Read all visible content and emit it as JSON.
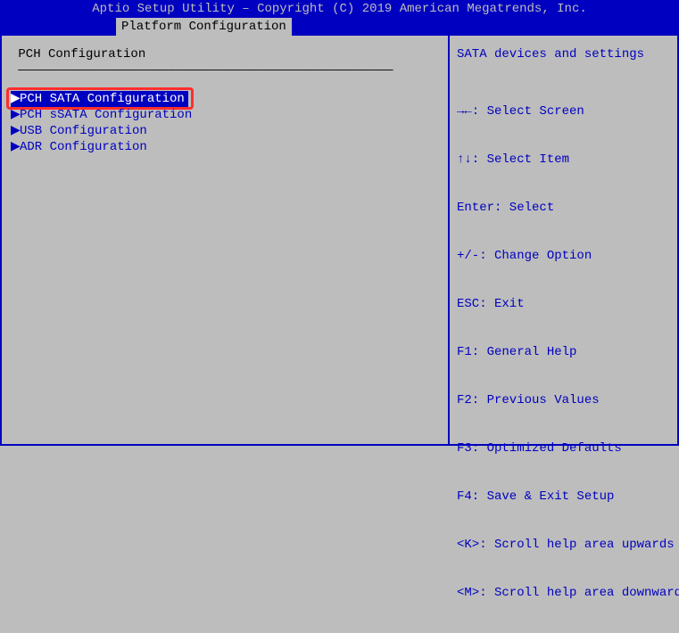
{
  "header": {
    "title": "Aptio Setup Utility – Copyright (C) 2019 American Megatrends, Inc.",
    "tab": "Platform Configuration"
  },
  "left": {
    "heading": " PCH Configuration",
    "divider": " ——————————————————————————————————————————————————",
    "items": [
      {
        "label": "PCH SATA Configuration",
        "selected": true
      },
      {
        "label": "PCH sSATA Configuration",
        "selected": false
      },
      {
        "label": "USB Configuration",
        "selected": false
      },
      {
        "label": "ADR Configuration",
        "selected": false
      }
    ]
  },
  "right": {
    "help": "SATA devices and settings",
    "divider": "————————————————————————————————",
    "keys": [
      "→←: Select Screen",
      "↑↓: Select Item",
      "Enter: Select",
      "+/-: Change Option",
      "ESC: Exit",
      "F1: General Help",
      "F2: Previous Values",
      "F3: Optimized Defaults",
      "F4: Save & Exit Setup",
      "<K>: Scroll help area upwards",
      "<M>: Scroll help area downwards"
    ]
  }
}
